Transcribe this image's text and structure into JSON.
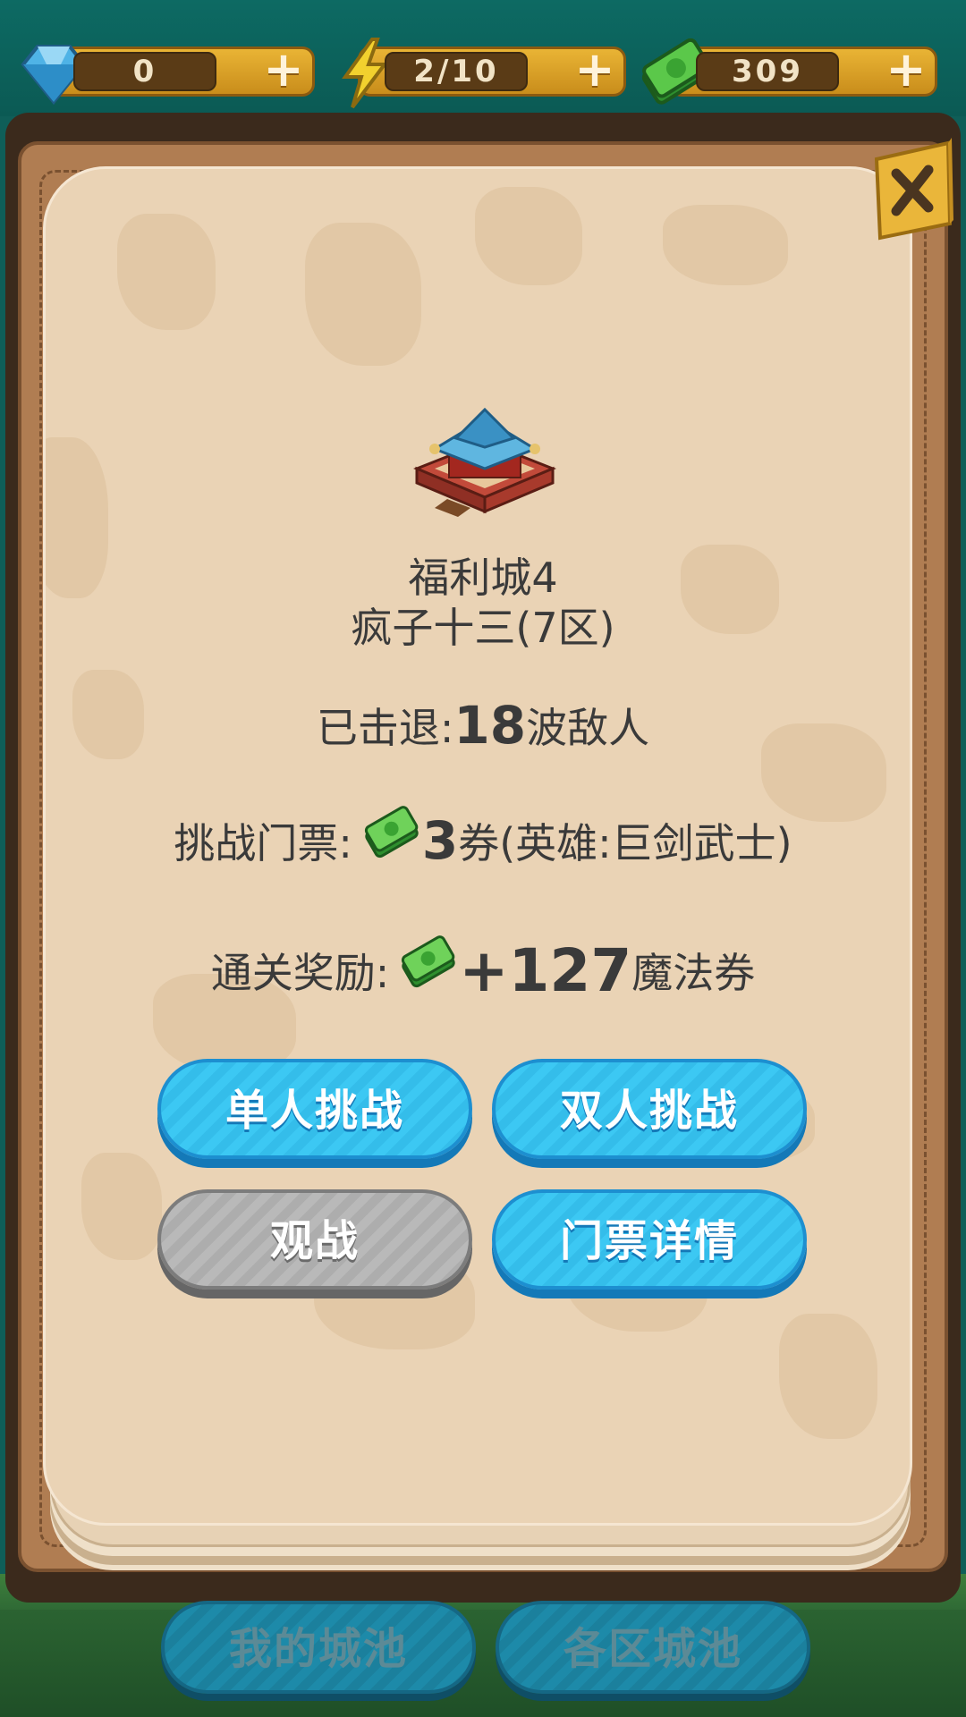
{
  "resources": {
    "gems": {
      "value": "0",
      "icon": "diamond-icon"
    },
    "energy": {
      "value": "2/10",
      "icon": "lightning-icon"
    },
    "cash": {
      "value": "309",
      "icon": "cash-icon"
    },
    "plus_label": "+"
  },
  "city": {
    "name": "福利城4",
    "owner": "疯子十三(7区)"
  },
  "stats": {
    "repelled_label": "已击退: ",
    "repelled_value": "18",
    "repelled_suffix": "波敌人",
    "ticket_label": "挑战门票: ",
    "ticket_value": "3",
    "ticket_suffix": "券(英雄:巨剑武士)",
    "reward_label": "通关奖励: ",
    "reward_value": "+127",
    "reward_suffix": "魔法券"
  },
  "buttons": {
    "solo": "单人挑战",
    "duo": "双人挑战",
    "watch": "观战",
    "ticket_details": "门票详情"
  },
  "bottom_tabs": {
    "my_city": "我的城池",
    "all_cities": "各区城池"
  },
  "colors": {
    "button_blue": "#3cc8f3",
    "button_gray": "#b9b9b9",
    "paper": "#ead3b5",
    "frame": "#b07d52"
  }
}
